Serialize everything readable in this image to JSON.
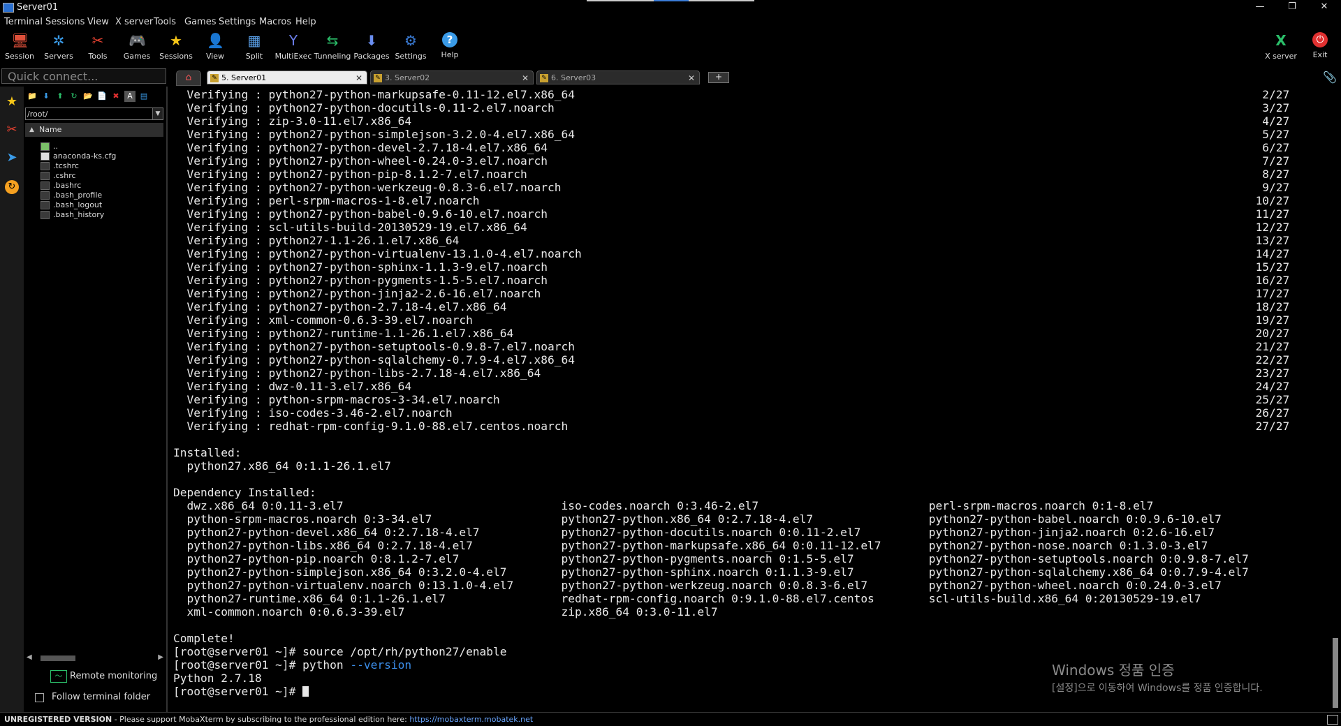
{
  "window": {
    "title": "Server01",
    "controls": [
      "—",
      "❐",
      "✕"
    ]
  },
  "menu": [
    "Terminal",
    "Sessions",
    "View",
    "X server",
    "Tools",
    "Games",
    "Settings",
    "Macros",
    "Help"
  ],
  "toolbar": {
    "left": [
      {
        "label": "Session",
        "icon": "session-icon",
        "glyph": "🖥",
        "color": "#e0503a"
      },
      {
        "label": "Servers",
        "icon": "servers-icon",
        "glyph": "✲",
        "color": "#3a9be8"
      },
      {
        "label": "Tools",
        "icon": "tools-icon",
        "glyph": "✂",
        "color": "#e04030"
      },
      {
        "label": "Games",
        "icon": "games-icon",
        "glyph": "🎮",
        "color": "#cccccc"
      },
      {
        "label": "Sessions",
        "icon": "sessions-star-icon",
        "glyph": "★",
        "color": "#f5c518"
      },
      {
        "label": "View",
        "icon": "view-icon",
        "glyph": "👤",
        "color": "#9fc4e8"
      },
      {
        "label": "Split",
        "icon": "split-icon",
        "glyph": "▦",
        "color": "#5aa0e8"
      },
      {
        "label": "MultiExec",
        "icon": "multiexec-icon",
        "glyph": "Y",
        "color": "#6a7de8"
      },
      {
        "label": "Tunneling",
        "icon": "tunneling-icon",
        "glyph": "⇆",
        "color": "#2bbf6a"
      },
      {
        "label": "Packages",
        "icon": "packages-icon",
        "glyph": "⬇",
        "color": "#6a8ef0"
      },
      {
        "label": "Settings",
        "icon": "settings-icon",
        "glyph": "⚙",
        "color": "#3a7bd5"
      },
      {
        "label": "Help",
        "icon": "help-icon",
        "glyph": "?",
        "color": "#3a9be8"
      }
    ],
    "right": [
      {
        "label": "X server",
        "icon": "xserver-icon",
        "glyph": "X",
        "color": "#2bbf6a"
      },
      {
        "label": "Exit",
        "icon": "exit-icon",
        "glyph": "⏻",
        "color": "#e03030"
      }
    ]
  },
  "quick_connect": {
    "placeholder": "Quick connect..."
  },
  "tabs": [
    {
      "label": "5. Server01",
      "active": true
    },
    {
      "label": "3. Server02",
      "active": false
    },
    {
      "label": "6. Server03",
      "active": false
    }
  ],
  "tab_close_glyph": "✕",
  "file_browser": {
    "path": "/root/",
    "column_header": "Name",
    "files": [
      {
        "name": "..",
        "kind": "up"
      },
      {
        "name": "anaconda-ks.cfg",
        "kind": "doc"
      },
      {
        "name": ".tcshrc",
        "kind": "file"
      },
      {
        "name": ".cshrc",
        "kind": "file"
      },
      {
        "name": ".bashrc",
        "kind": "file"
      },
      {
        "name": ".bash_profile",
        "kind": "file"
      },
      {
        "name": ".bash_logout",
        "kind": "file"
      },
      {
        "name": ".bash_history",
        "kind": "file"
      }
    ],
    "remote_monitoring": "Remote monitoring",
    "follow_terminal_folder": "Follow terminal folder"
  },
  "terminal": {
    "verifying": [
      {
        "pkg": "python27-python-markupsafe-0.11-12.el7.x86_64",
        "n": "2/27"
      },
      {
        "pkg": "python27-python-docutils-0.11-2.el7.noarch",
        "n": "3/27"
      },
      {
        "pkg": "zip-3.0-11.el7.x86_64",
        "n": "4/27"
      },
      {
        "pkg": "python27-python-simplejson-3.2.0-4.el7.x86_64",
        "n": "5/27"
      },
      {
        "pkg": "python27-python-devel-2.7.18-4.el7.x86_64",
        "n": "6/27"
      },
      {
        "pkg": "python27-python-wheel-0.24.0-3.el7.noarch",
        "n": "7/27"
      },
      {
        "pkg": "python27-python-pip-8.1.2-7.el7.noarch",
        "n": "8/27"
      },
      {
        "pkg": "python27-python-werkzeug-0.8.3-6.el7.noarch",
        "n": "9/27"
      },
      {
        "pkg": "perl-srpm-macros-1-8.el7.noarch",
        "n": "10/27"
      },
      {
        "pkg": "python27-python-babel-0.9.6-10.el7.noarch",
        "n": "11/27"
      },
      {
        "pkg": "scl-utils-build-20130529-19.el7.x86_64",
        "n": "12/27"
      },
      {
        "pkg": "python27-1.1-26.1.el7.x86_64",
        "n": "13/27"
      },
      {
        "pkg": "python27-python-virtualenv-13.1.0-4.el7.noarch",
        "n": "14/27"
      },
      {
        "pkg": "python27-python-sphinx-1.1.3-9.el7.noarch",
        "n": "15/27"
      },
      {
        "pkg": "python27-python-pygments-1.5-5.el7.noarch",
        "n": "16/27"
      },
      {
        "pkg": "python27-python-jinja2-2.6-16.el7.noarch",
        "n": "17/27"
      },
      {
        "pkg": "python27-python-2.7.18-4.el7.x86_64",
        "n": "18/27"
      },
      {
        "pkg": "xml-common-0.6.3-39.el7.noarch",
        "n": "19/27"
      },
      {
        "pkg": "python27-runtime-1.1-26.1.el7.x86_64",
        "n": "20/27"
      },
      {
        "pkg": "python27-python-setuptools-0.9.8-7.el7.noarch",
        "n": "21/27"
      },
      {
        "pkg": "python27-python-sqlalchemy-0.7.9-4.el7.x86_64",
        "n": "22/27"
      },
      {
        "pkg": "python27-python-libs-2.7.18-4.el7.x86_64",
        "n": "23/27"
      },
      {
        "pkg": "dwz-0.11-3.el7.x86_64",
        "n": "24/27"
      },
      {
        "pkg": "python-srpm-macros-3-34.el7.noarch",
        "n": "25/27"
      },
      {
        "pkg": "iso-codes-3.46-2.el7.noarch",
        "n": "26/27"
      },
      {
        "pkg": "redhat-rpm-config-9.1.0-88.el7.centos.noarch",
        "n": "27/27"
      }
    ],
    "verifying_word": "Verifying",
    "installed_header": "Installed:",
    "installed": [
      "python27.x86_64 0:1.1-26.1.el7"
    ],
    "dependency_header": "Dependency Installed:",
    "dependency_rows": [
      [
        "dwz.x86_64 0:0.11-3.el7",
        "iso-codes.noarch 0:3.46-2.el7",
        "perl-srpm-macros.noarch 0:1-8.el7"
      ],
      [
        "python-srpm-macros.noarch 0:3-34.el7",
        "python27-python.x86_64 0:2.7.18-4.el7",
        "python27-python-babel.noarch 0:0.9.6-10.el7"
      ],
      [
        "python27-python-devel.x86_64 0:2.7.18-4.el7",
        "python27-python-docutils.noarch 0:0.11-2.el7",
        "python27-python-jinja2.noarch 0:2.6-16.el7"
      ],
      [
        "python27-python-libs.x86_64 0:2.7.18-4.el7",
        "python27-python-markupsafe.x86_64 0:0.11-12.el7",
        "python27-python-nose.noarch 0:1.3.0-3.el7"
      ],
      [
        "python27-python-pip.noarch 0:8.1.2-7.el7",
        "python27-python-pygments.noarch 0:1.5-5.el7",
        "python27-python-setuptools.noarch 0:0.9.8-7.el7"
      ],
      [
        "python27-python-simplejson.x86_64 0:3.2.0-4.el7",
        "python27-python-sphinx.noarch 0:1.1.3-9.el7",
        "python27-python-sqlalchemy.x86_64 0:0.7.9-4.el7"
      ],
      [
        "python27-python-virtualenv.noarch 0:13.1.0-4.el7",
        "python27-python-werkzeug.noarch 0:0.8.3-6.el7",
        "python27-python-wheel.noarch 0:0.24.0-3.el7"
      ],
      [
        "python27-runtime.x86_64 0:1.1-26.1.el7",
        "redhat-rpm-config.noarch 0:9.1.0-88.el7.centos",
        "scl-utils-build.x86_64 0:20130529-19.el7"
      ],
      [
        "xml-common.noarch 0:0.6.3-39.el7",
        "zip.x86_64 0:3.0-11.el7",
        ""
      ]
    ],
    "complete": "Complete!",
    "prompt": "[root@server01 ~]#",
    "cmd1": "source /opt/rh/python27/enable",
    "cmd2_prog": "python",
    "cmd2_flag": "--version",
    "output": "Python 2.7.18"
  },
  "activation": {
    "title": "Windows 정품 인증",
    "subtitle": "[설정]으로 이동하여 Windows를 정품 인증합니다."
  },
  "status": {
    "unregistered": "UNREGISTERED VERSION",
    "message": "  -  Please support MobaXterm by subscribing to the professional edition here:  ",
    "url": "https://mobaxterm.mobatek.net"
  }
}
